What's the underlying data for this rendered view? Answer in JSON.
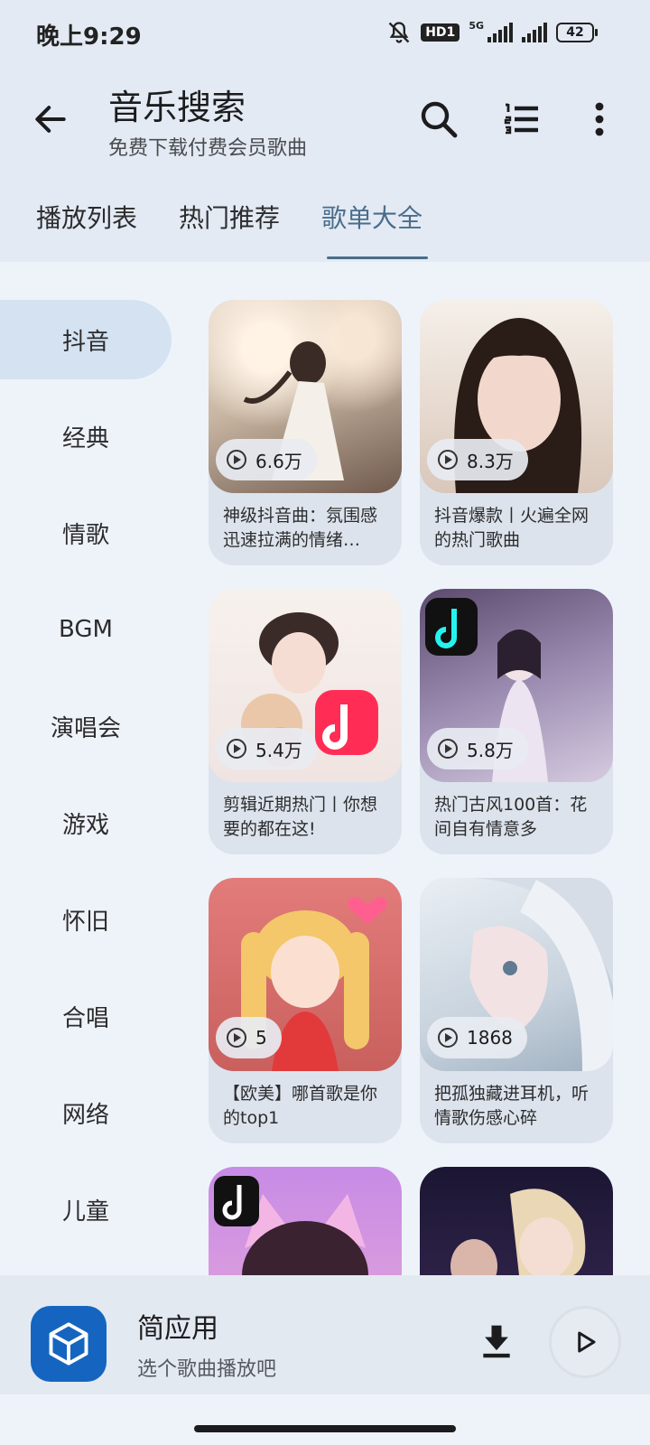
{
  "status_bar": {
    "time": "晚上9:29",
    "hd_label": "HD1",
    "network": "5G",
    "battery": "42"
  },
  "header": {
    "title": "音乐搜索",
    "subtitle": "免费下载付费会员歌曲",
    "tabs": [
      {
        "label": "播放列表",
        "active": false
      },
      {
        "label": "热门推荐",
        "active": false
      },
      {
        "label": "歌单大全",
        "active": true
      }
    ]
  },
  "sidebar": {
    "categories": [
      {
        "label": "抖音",
        "active": true
      },
      {
        "label": "经典"
      },
      {
        "label": "情歌"
      },
      {
        "label": "BGM"
      },
      {
        "label": "演唱会"
      },
      {
        "label": "游戏"
      },
      {
        "label": "怀旧"
      },
      {
        "label": "合唱"
      },
      {
        "label": "网络"
      },
      {
        "label": "儿童"
      }
    ]
  },
  "playlists": [
    {
      "plays": "6.6万",
      "name": "神级抖音曲：氛围感迅速拉满的情绪…"
    },
    {
      "plays": "8.3万",
      "name": "抖音爆款丨火遍全网的热门歌曲"
    },
    {
      "plays": "5.4万",
      "name": "剪辑近期热门丨你想要的都在这!"
    },
    {
      "plays": "5.8万",
      "name": "热门古风100首：花间自有情意多"
    },
    {
      "plays": "5",
      "name": "【欧美】哪首歌是你的top1"
    },
    {
      "plays": "1868",
      "name": "把孤独藏进耳机，听情歌伤感心碎"
    }
  ],
  "player": {
    "app_name": "简应用",
    "hint": "选个歌曲播放吧"
  },
  "colors": {
    "accent": "#4a6d8c",
    "app_icon": "#1565c0",
    "selected_bg": "#d4e2f1"
  }
}
